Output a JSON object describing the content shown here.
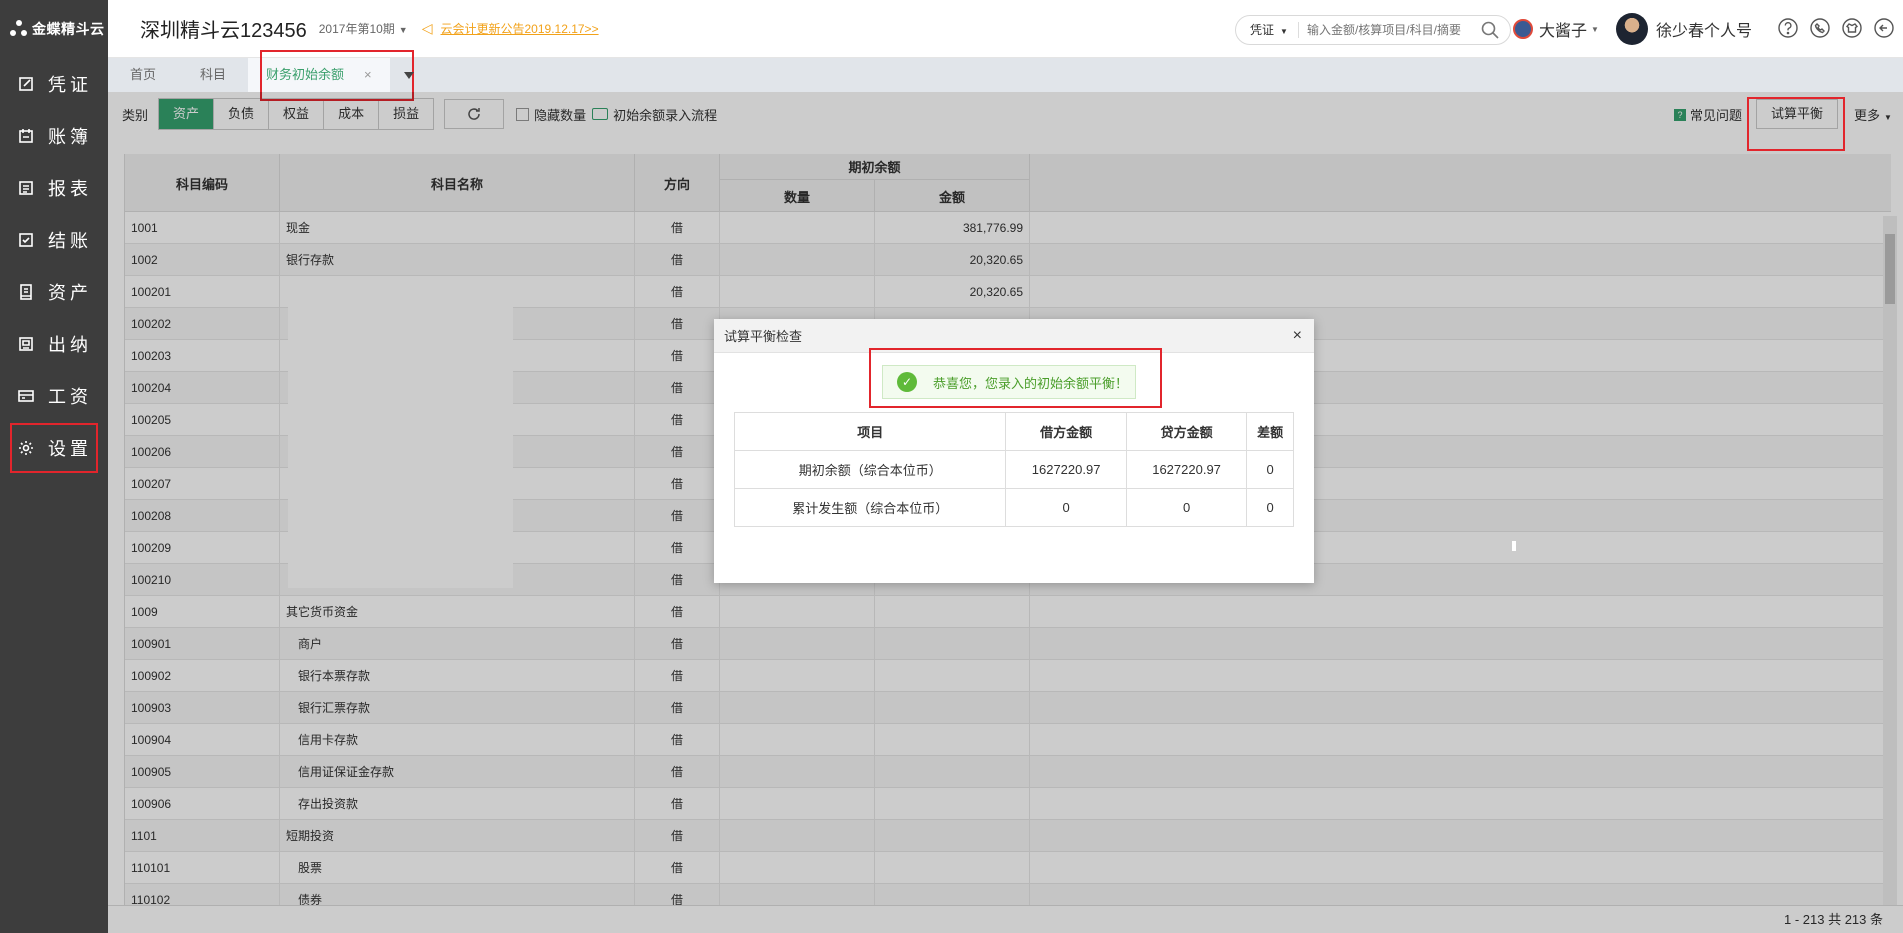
{
  "brand": {
    "name": "金蝶精斗云"
  },
  "sidebar": {
    "items": [
      {
        "label": "凭证",
        "icon": "edit-icon"
      },
      {
        "label": "账簿",
        "icon": "book-icon"
      },
      {
        "label": "报表",
        "icon": "report-icon"
      },
      {
        "label": "结账",
        "icon": "checkbox-icon"
      },
      {
        "label": "资产",
        "icon": "asset-icon"
      },
      {
        "label": "出纳",
        "icon": "cashier-icon"
      },
      {
        "label": "工资",
        "icon": "salary-icon"
      },
      {
        "label": "设置",
        "icon": "gear-icon"
      }
    ]
  },
  "header": {
    "company": "深圳精斗云123456",
    "period": "2017年第10期",
    "notice": "云会计更新公告2019.12.17>>",
    "search_type": "凭证",
    "search_placeholder": "输入金额/核算项目/科目/摘要",
    "user1": "大酱子",
    "user2": "徐少春个人号"
  },
  "tabs": [
    {
      "label": "首页"
    },
    {
      "label": "科目"
    },
    {
      "label": "财务初始余额",
      "close": "×"
    }
  ],
  "toolbar": {
    "category_label": "类别",
    "categories": [
      "资产",
      "负债",
      "权益",
      "成本",
      "损益"
    ],
    "hide_qty": "隐藏数量",
    "flow": "初始余额录入流程",
    "faq": "常见问题",
    "trial_balance": "试算平衡",
    "more": "更多"
  },
  "table": {
    "headers": {
      "code": "科目编码",
      "name": "科目名称",
      "direction": "方向",
      "opening": "期初余额",
      "qty": "数量",
      "amount": "金额"
    },
    "rows": [
      {
        "code": "1001",
        "name": "现金",
        "dir": "借",
        "qty": "",
        "amount": "381,776.99",
        "indent": false
      },
      {
        "code": "1002",
        "name": "银行存款",
        "dir": "借",
        "qty": "",
        "amount": "20,320.65",
        "indent": false
      },
      {
        "code": "100201",
        "name": "",
        "dir": "借",
        "qty": "",
        "amount": "20,320.65",
        "indent": true
      },
      {
        "code": "100202",
        "name": "",
        "dir": "借",
        "qty": "",
        "amount": "",
        "indent": true
      },
      {
        "code": "100203",
        "name": "",
        "dir": "借",
        "qty": "",
        "amount": "",
        "indent": true
      },
      {
        "code": "100204",
        "name": "",
        "dir": "借",
        "qty": "",
        "amount": "",
        "indent": true
      },
      {
        "code": "100205",
        "name": "",
        "dir": "借",
        "qty": "",
        "amount": "",
        "indent": true
      },
      {
        "code": "100206",
        "name": "",
        "dir": "借",
        "qty": "",
        "amount": "",
        "indent": true
      },
      {
        "code": "100207",
        "name": "",
        "dir": "借",
        "qty": "",
        "amount": "",
        "indent": true
      },
      {
        "code": "100208",
        "name": "",
        "dir": "借",
        "qty": "",
        "amount": "",
        "indent": true
      },
      {
        "code": "100209",
        "name": "",
        "dir": "借",
        "qty": "",
        "amount": "",
        "indent": true
      },
      {
        "code": "100210",
        "name": "",
        "dir": "借",
        "qty": "",
        "amount": "",
        "indent": true
      },
      {
        "code": "1009",
        "name": "其它货币资金",
        "dir": "借",
        "qty": "",
        "amount": "",
        "indent": false
      },
      {
        "code": "100901",
        "name": "商户",
        "dir": "借",
        "qty": "",
        "amount": "",
        "indent": true
      },
      {
        "code": "100902",
        "name": "银行本票存款",
        "dir": "借",
        "qty": "",
        "amount": "",
        "indent": true
      },
      {
        "code": "100903",
        "name": "银行汇票存款",
        "dir": "借",
        "qty": "",
        "amount": "",
        "indent": true
      },
      {
        "code": "100904",
        "name": "信用卡存款",
        "dir": "借",
        "qty": "",
        "amount": "",
        "indent": true
      },
      {
        "code": "100905",
        "name": "信用证保证金存款",
        "dir": "借",
        "qty": "",
        "amount": "",
        "indent": true
      },
      {
        "code": "100906",
        "name": "存出投资款",
        "dir": "借",
        "qty": "",
        "amount": "",
        "indent": true
      },
      {
        "code": "1101",
        "name": "短期投资",
        "dir": "借",
        "qty": "",
        "amount": "",
        "indent": false
      },
      {
        "code": "110101",
        "name": "股票",
        "dir": "借",
        "qty": "",
        "amount": "",
        "indent": true
      },
      {
        "code": "110102",
        "name": "债券",
        "dir": "借",
        "qty": "",
        "amount": "",
        "indent": true
      }
    ]
  },
  "pagination": "1 - 213   共 213 条",
  "dialog": {
    "title": "试算平衡检查",
    "close": "×",
    "message": "恭喜您，您录入的初始余额平衡！",
    "headers": [
      "项目",
      "借方金额",
      "贷方金额",
      "差额"
    ],
    "rows": [
      [
        "期初余额（综合本位币）",
        "1627220.97",
        "1627220.97",
        "0"
      ],
      [
        "累计发生额（综合本位币）",
        "0",
        "0",
        "0"
      ]
    ]
  },
  "colors": {
    "accent": "#35a26e",
    "highlight": "#e2252c",
    "notice": "#f2a21a",
    "sidebar": "#3d3d3d"
  }
}
